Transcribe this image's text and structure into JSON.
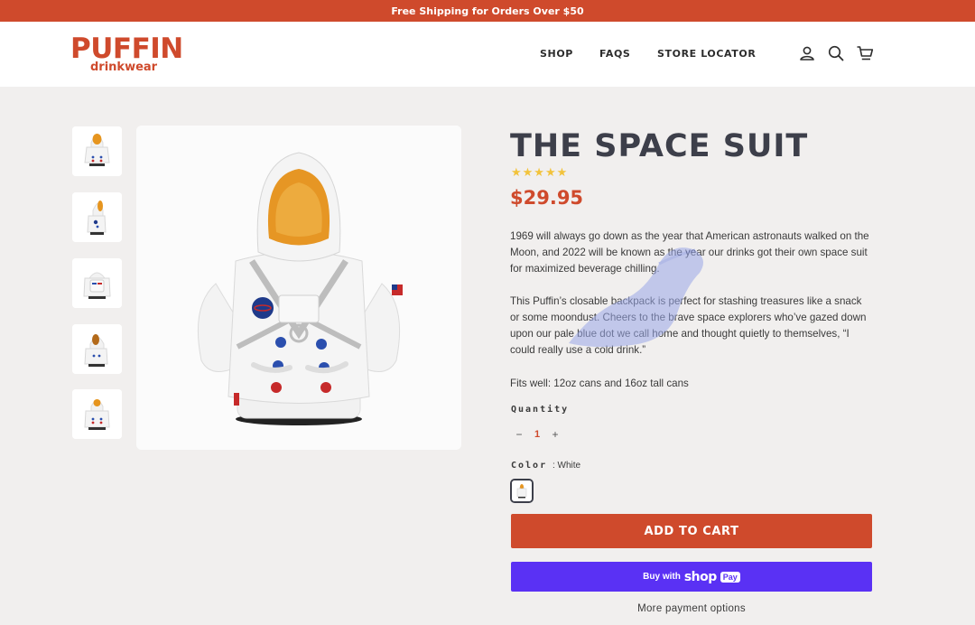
{
  "announcement": {
    "text": "Free Shipping for Orders Over $50"
  },
  "brand": {
    "logo_top": "PUFFIN",
    "logo_bottom": "drinkwear",
    "color": "#cf4a2c"
  },
  "nav": {
    "items": [
      "SHOP",
      "FAQS",
      "STORE LOCATOR"
    ]
  },
  "header_icons": [
    "account-icon",
    "search-icon",
    "cart-icon"
  ],
  "gallery": {
    "thumbnails": 5
  },
  "product": {
    "title": "THE SPACE SUIT",
    "rating_stars": "★★★★★",
    "rating": 4.5,
    "price": "$29.95",
    "description_1": "1969 will always go down as the year that American astronauts walked on the Moon, and 2022 will be known as the year our drinks got their own space suit for maximized beverage chilling.",
    "description_2": "This Puffin’s closable backpack is perfect for stashing treasures like a snack or some moondust. Cheers to the brave space explorers who’ve gazed down upon our pale blue dot we call home and thought quietly to themselves, “I could really use a cold drink.”",
    "fits": "Fits well: 12oz cans and 16oz tall cans"
  },
  "quantity": {
    "label": "Quantity",
    "minus": "−",
    "value": "1",
    "plus": "+"
  },
  "color": {
    "label": "Color",
    "value": ": White"
  },
  "buttons": {
    "add_to_cart": "ADD TO CART",
    "shoppay_buy": "Buy with",
    "shoppay_shop": "shop",
    "shoppay_pay": "Pay",
    "more_payment": "More payment options"
  },
  "colors": {
    "accent": "#cf4a2c",
    "shoppay": "#5a31f4",
    "title": "#3d3f4a",
    "stars": "#f2c33c"
  }
}
